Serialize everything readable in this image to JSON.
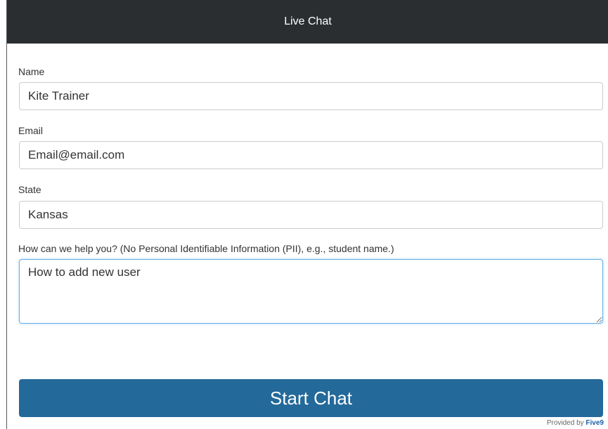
{
  "header": {
    "title": "Live Chat"
  },
  "form": {
    "name": {
      "label": "Name",
      "value": "Kite Trainer"
    },
    "email": {
      "label": "Email",
      "value": "Email@email.com"
    },
    "state": {
      "label": "State",
      "value": "Kansas"
    },
    "question": {
      "label": "How can we help you? (No Personal Identifiable Information (PII), e.g., student name.)",
      "value": "How to add new user"
    }
  },
  "actions": {
    "start_chat_label": "Start Chat"
  },
  "footer": {
    "provided_by": "Provided by ",
    "brand": "Five9"
  },
  "colors": {
    "header_bg": "#2b2e31",
    "button_bg": "#23699a",
    "focus_border": "#66afe9",
    "brand": "#1f5fa8"
  }
}
